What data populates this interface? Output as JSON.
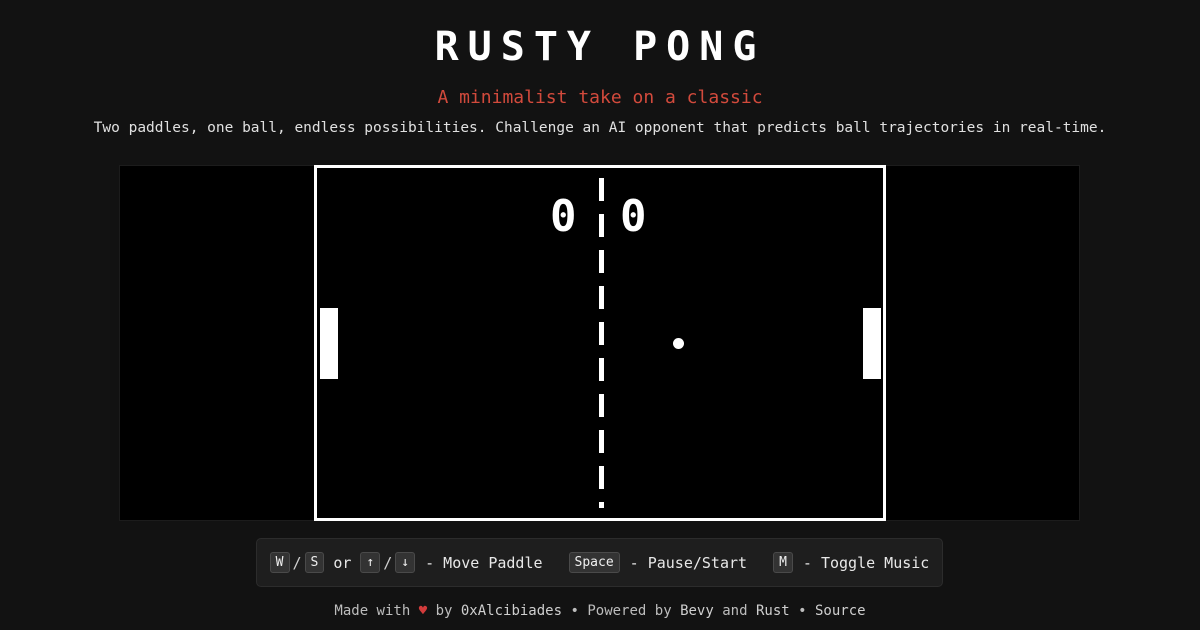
{
  "header": {
    "title": "RUSTY PONG",
    "subtitle": "A minimalist take on a classic",
    "tagline": "Two paddles, one ball, endless possibilities. Challenge an AI opponent that predicts ball trajectories in real-time."
  },
  "game": {
    "score_left": "0",
    "score_right": "0"
  },
  "controls": {
    "key_w": "W",
    "slash_1": "/",
    "key_s": "S",
    "or_text": "or",
    "key_up": "↑",
    "slash_2": "/",
    "key_down": "↓",
    "move_label": "- Move Paddle",
    "key_space": "Space",
    "pause_label": "- Pause/Start",
    "key_m": "M",
    "music_label": "- Toggle Music"
  },
  "footer": {
    "made_with": "Made with",
    "heart": "♥",
    "by_text": "by",
    "author": "0xAlcibiades",
    "bullet_1": "•",
    "powered_by": "Powered by",
    "bevy": "Bevy",
    "and_text": "and",
    "rust": "Rust",
    "bullet_2": "•",
    "source": "Source"
  },
  "colors": {
    "background": "#121212",
    "accent": "#d24a3c",
    "heart": "#d23b3b",
    "court": "#000000",
    "lines": "#ffffff"
  }
}
